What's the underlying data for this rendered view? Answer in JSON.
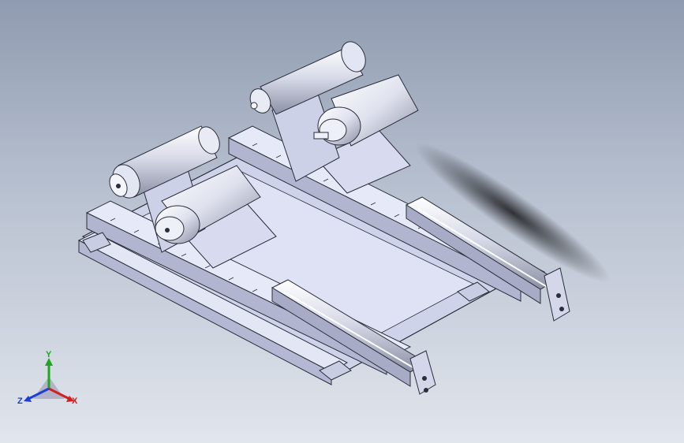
{
  "viewport": {
    "background_top": "#8f9bb0",
    "background_bottom": "#e1e5ec"
  },
  "model": {
    "part_fill": "#d9dcef",
    "part_shade": "#b7bbd6",
    "edge_color": "#2b2d3a",
    "motor_color": "#e8ebf6"
  },
  "triad": {
    "x_label": "X",
    "y_label": "Y",
    "z_label": "Z",
    "x_color": "#d21f1f",
    "y_color": "#1fa51f",
    "z_color": "#1f3fd2"
  }
}
